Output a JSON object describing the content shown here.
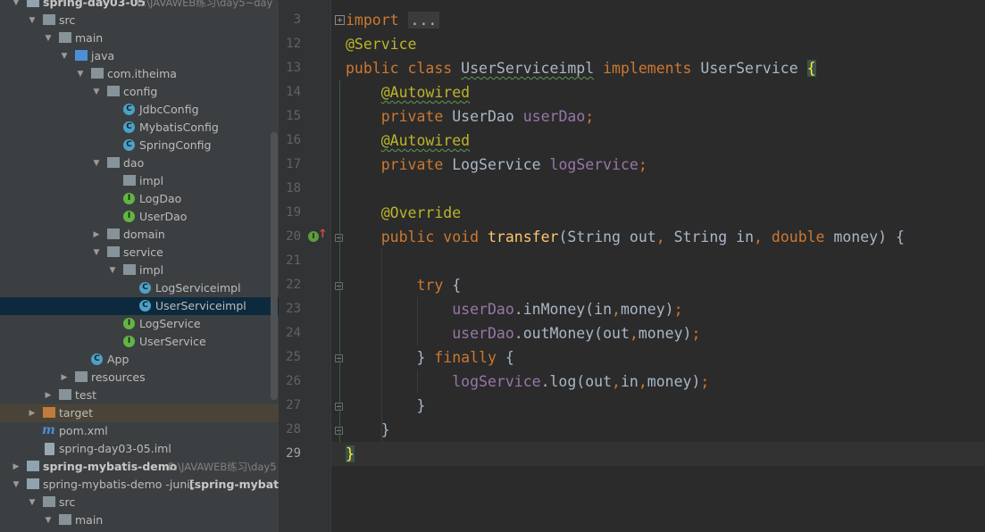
{
  "project_tree": {
    "rows": [
      {
        "label": "spring-day03-05",
        "path": "E:\\JAVAWEB练习\\day5~day",
        "bold": true
      },
      {
        "label": "src"
      },
      {
        "label": "main"
      },
      {
        "label": "java"
      },
      {
        "label": "com.itheima"
      },
      {
        "label": "config"
      },
      {
        "label": "JdbcConfig",
        "badge": "C"
      },
      {
        "label": "MybatisConfig",
        "badge": "C"
      },
      {
        "label": "SpringConfig",
        "badge": "C"
      },
      {
        "label": "dao"
      },
      {
        "label": "impl"
      },
      {
        "label": "LogDao",
        "badge": "I"
      },
      {
        "label": "UserDao",
        "badge": "I"
      },
      {
        "label": "domain"
      },
      {
        "label": "service"
      },
      {
        "label": "impl"
      },
      {
        "label": "LogServiceimpl",
        "badge": "C"
      },
      {
        "label": "UserServiceimpl",
        "badge": "C"
      },
      {
        "label": "LogService",
        "badge": "I"
      },
      {
        "label": "UserService",
        "badge": "I"
      },
      {
        "label": "App",
        "badge": "C"
      },
      {
        "label": "resources"
      },
      {
        "label": "test"
      },
      {
        "label": "target"
      },
      {
        "label": "pom.xml",
        "badge": "m"
      },
      {
        "label": "spring-day03-05.iml"
      },
      {
        "label": "spring-mybatis-demo",
        "path": "E:\\JAVAWEB练习\\day5",
        "bold": true
      },
      {
        "label": "spring-mybatis-demo -junit",
        "path": "[spring-mybatis-",
        "bold_path": true
      },
      {
        "label": "src"
      },
      {
        "label": "main"
      }
    ]
  },
  "editor": {
    "line_numbers": [
      "3",
      "12",
      "13",
      "14",
      "15",
      "16",
      "17",
      "18",
      "19",
      "20",
      "21",
      "22",
      "23",
      "24",
      "25",
      "26",
      "27",
      "28",
      "29"
    ],
    "current_line": "29",
    "code": {
      "l3_kw": "import",
      "l3_folded": "...",
      "l12_ann": "@Service",
      "l13_kw1": "public class",
      "l13_name": "UserServiceimpl",
      "l13_kw2": "implements",
      "l13_iface": "UserService",
      "l13_brace": "{",
      "l14_ann": "@Autowired",
      "l15_kw": "private",
      "l15_type": "UserDao",
      "l15_field": "userDao",
      "l15_semi": ";",
      "l16_ann": "@Autowired",
      "l17_kw": "private",
      "l17_type": "LogService",
      "l17_field": "logService",
      "l17_semi": ";",
      "l19_ann": "@Override",
      "l20_kw": "public void",
      "l20_fn": "transfer",
      "l20_p1": "(String out",
      "l20_c1": ",",
      "l20_p2": "String in",
      "l20_c2": ",",
      "l20_kw2": "double",
      "l20_p3": "money) {",
      "l22_kw": "try",
      "l22_rest": "{",
      "l23_field": "userDao",
      "l23_call": ".inMoney(in",
      "l23_comma": ",",
      "l23_rest": "money)",
      "l23_semi": ";",
      "l24_field": "userDao",
      "l24_call": ".outMoney(out",
      "l24_comma": ",",
      "l24_rest": "money)",
      "l24_semi": ";",
      "l25_close": "}",
      "l25_kw": "finally",
      "l25_open": "{",
      "l26_field": "logService",
      "l26_call": ".log(out",
      "l26_c1": ",",
      "l26_mid": "in",
      "l26_c2": ",",
      "l26_rest": "money)",
      "l26_semi": ";",
      "l27": "}",
      "l28": "}",
      "l29": "}"
    }
  }
}
